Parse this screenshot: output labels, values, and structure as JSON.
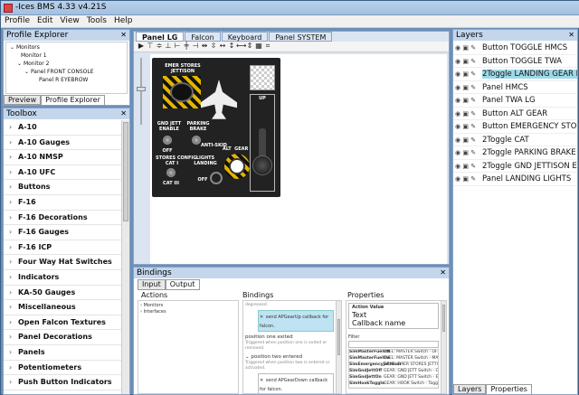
{
  "app": {
    "title": "-Ices BMS 4.33 v4.21S"
  },
  "menu": [
    "Profile",
    "Edit",
    "View",
    "Tools",
    "Help"
  ],
  "profile_explorer": {
    "title": "Profile Explorer",
    "tree": [
      {
        "label": "Monitors",
        "depth": 0
      },
      {
        "label": "Monitor 1",
        "depth": 1
      },
      {
        "label": "Monitor 2",
        "depth": 1
      },
      {
        "label": "Panel FRONT CONSOLE",
        "depth": 2
      },
      {
        "label": "Panel R EYEBROW",
        "depth": 3
      }
    ],
    "tabs": [
      "Preview",
      "Profile Explorer"
    ]
  },
  "toolbox": {
    "title": "Toolbox",
    "items": [
      "A-10",
      "A-10 Gauges",
      "A-10 NMSP",
      "A-10 UFC",
      "Buttons",
      "F-16",
      "F-16 Decorations",
      "F-16 Gauges",
      "F-16 ICP",
      "Four Way Hat Switches",
      "Indicators",
      "KA-50 Gauges",
      "Miscellaneous",
      "Open Falcon Textures",
      "Panel Decorations",
      "Panels",
      "Potentiometers",
      "Push Button Indicators"
    ]
  },
  "document_tabs": [
    "Panel LG",
    "Falcon",
    "Keyboard",
    "Panel SYSTEM"
  ],
  "panel": {
    "labels": {
      "emer_stores": "EMER STORES\nJETTISON",
      "gnd_jett": "GND JETT\nENABLE",
      "parking_brake": "PARKING\nBRAKE",
      "off1": "OFF",
      "anti_skid": "ANTI-SKID",
      "alt_gear": "ALT  GEAR",
      "up": "UP",
      "stores_config": "STORES CONFIG\nCAT I",
      "cat_iii": "CAT III",
      "lights": "LIGHTS\nLANDING",
      "off2": "OFF"
    }
  },
  "layers": {
    "title": "Layers",
    "items": [
      {
        "label": "Button TOGGLE HMCS",
        "selected": false
      },
      {
        "label": "Button TOGGLE TWA",
        "selected": false
      },
      {
        "label": "2Toggle LANDING GEAR HAN",
        "selected": true
      },
      {
        "label": "Panel HMCS",
        "selected": false
      },
      {
        "label": "Panel TWA LG",
        "selected": false
      },
      {
        "label": "Button ALT GEAR",
        "selected": false
      },
      {
        "label": "Button EMERGENCY STORE",
        "selected": false
      },
      {
        "label": "2Toggle CAT",
        "selected": false
      },
      {
        "label": "2Toggle PARKING BRAKE",
        "selected": false
      },
      {
        "label": "2Toggle GND JETTISON EN",
        "selected": false
      },
      {
        "label": "Panel LANDING LIGHTS",
        "selected": false
      }
    ],
    "tabs": [
      "Layers",
      "Properties"
    ]
  },
  "bindings": {
    "title": "Bindings",
    "tabs": [
      "Input",
      "Output"
    ],
    "headers": {
      "actions": "Actions",
      "bindings": "Bindings",
      "properties": "Properties"
    },
    "actions_tree": [
      "Monitors",
      "Interfaces"
    ],
    "binding_items": {
      "top_greyed": "degreased.",
      "send1": "send APGearUp callback for falcon.",
      "pos1_title": "position one exited",
      "pos1_sub": "Triggered when position one is exited or removed.",
      "pos2_title": "position two entered",
      "pos2_sub": "Triggered when position two is entered or activated.",
      "send2": "send APGearDown callback for falcon."
    },
    "properties": {
      "action_value_label": "Action Value",
      "opt1": "Text",
      "opt2": "Callback name",
      "filter_label": "Filter",
      "rows": [
        {
          "name": "SimMasterFuelOff",
          "desc": "FUEL: MASTER Switch - OFF"
        },
        {
          "name": "SimMasterFuelOn",
          "desc": "FUEL: MASTER Switch - MASTER"
        },
        {
          "name": "SimEmergencyJettison",
          "desc": "GEAR: EMER STORES JETTISON"
        },
        {
          "name": "SimGndJettOff",
          "desc": "GEAR: GND JETT Switch - OFF"
        },
        {
          "name": "SimGndJettOn",
          "desc": "GEAR: GND JETT Switch - ENABLE"
        },
        {
          "name": "SimHookToggle",
          "desc": "GEAR: HOOK Switch - Toggle"
        }
      ]
    }
  }
}
